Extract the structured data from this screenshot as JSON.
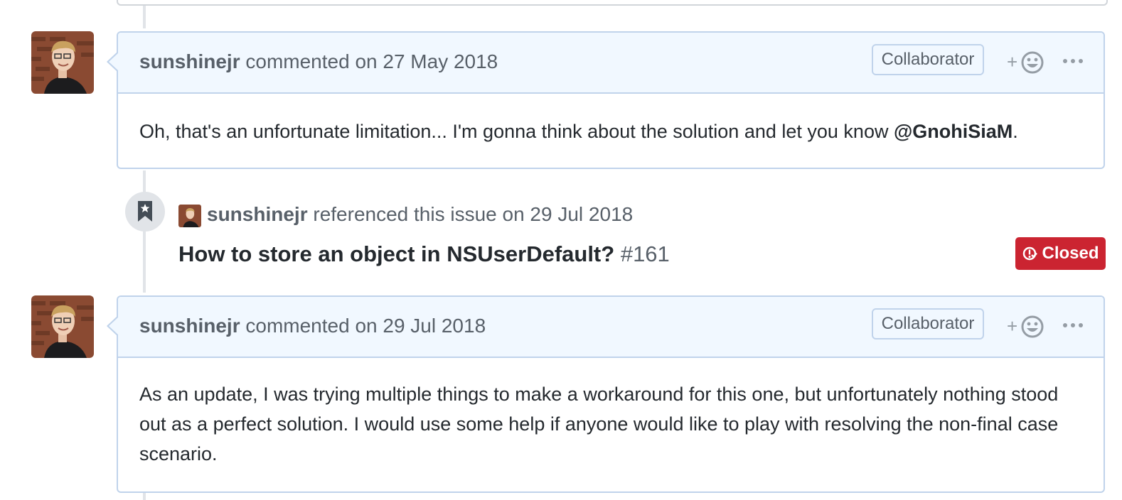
{
  "comments": [
    {
      "author": "sunshinejr",
      "action": "commented on 27 May 2018",
      "badge": "Collaborator",
      "body_text": "Oh, that's an unfortunate limitation... I'm gonna think about the solution and let you know ",
      "body_mention": "@GnohiSiaM",
      "body_end": "."
    },
    {
      "author": "sunshinejr",
      "action": "commented on 29 Jul 2018",
      "badge": "Collaborator",
      "body_text": "As an update, I was trying multiple things to make a workaround for this one, but unfortunately nothing stood out as a perfect solution. I would use some help if anyone would like to play with resolving the non-final case scenario."
    }
  ],
  "reference": {
    "author": "sunshinejr",
    "action": "referenced this issue on 29 Jul 2018",
    "issue_title": "How to store an object in NSUserDefault?",
    "issue_number": "#161",
    "status": "Closed",
    "status_color": "#cb2431"
  },
  "icons": {
    "reaction_plus": "+",
    "bookmark": "bookmark-icon",
    "reaction": "smiley-icon",
    "more": "kebab-horizontal-icon",
    "issue_closed": "issue-closed-icon"
  },
  "colors": {
    "header_bg": "#f1f8ff",
    "border": "#c0d3eb",
    "timeline": "#e1e4e8"
  }
}
